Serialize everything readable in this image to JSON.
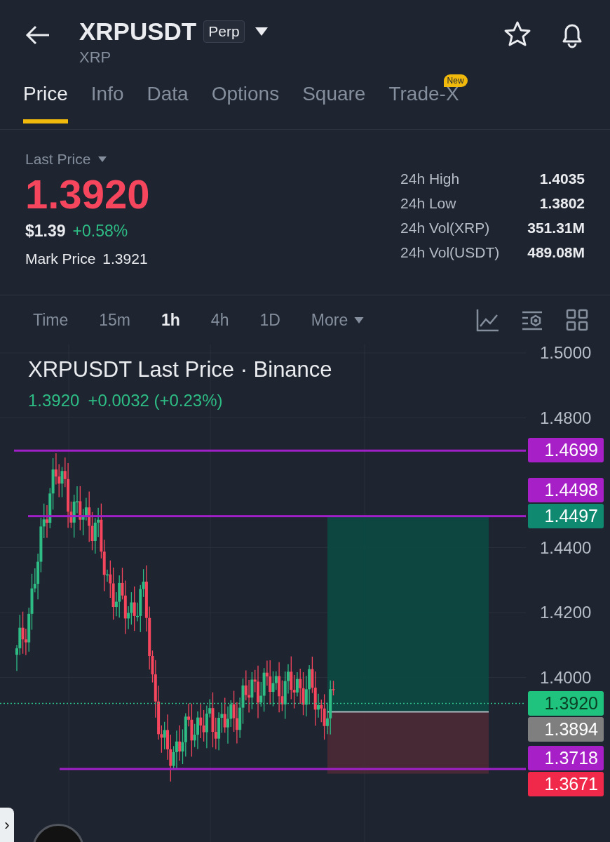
{
  "header": {
    "symbol": "XRPUSDT",
    "badge": "Perp",
    "subtitle": "XRP"
  },
  "tabs": [
    {
      "label": "Price",
      "selected": true
    },
    {
      "label": "Info",
      "selected": false
    },
    {
      "label": "Data",
      "selected": false
    },
    {
      "label": "Options",
      "selected": false
    },
    {
      "label": "Square",
      "selected": false
    },
    {
      "label": "Trade-X",
      "selected": false,
      "badge": "New"
    }
  ],
  "price": {
    "label": "Last Price",
    "value": "1.3920",
    "usd": "$1.39",
    "change": "+0.58%",
    "mark_label": "Mark Price",
    "mark_value": "1.3921"
  },
  "stats": [
    {
      "label": "24h High",
      "value": "1.4035"
    },
    {
      "label": "24h Low",
      "value": "1.3802"
    },
    {
      "label": "24h Vol(XRP)",
      "value": "351.31M"
    },
    {
      "label": "24h Vol(USDT)",
      "value": "489.08M"
    }
  ],
  "intervals": [
    {
      "label": "Time",
      "selected": false
    },
    {
      "label": "15m",
      "selected": false
    },
    {
      "label": "1h",
      "selected": true
    },
    {
      "label": "4h",
      "selected": false
    },
    {
      "label": "1D",
      "selected": false
    }
  ],
  "more": "More",
  "chart": {
    "title": "XRPUSDT Last Price · Binance",
    "last": "1.3920",
    "change": "+0.0032 (+0.23%)",
    "y_ticks": [
      "1.5000",
      "1.4800",
      "1.4400",
      "1.4200",
      "1.4000"
    ],
    "tags": [
      {
        "value": "1.4699",
        "color": "#a71fc6",
        "line": true
      },
      {
        "value": "1.4498",
        "color": "#a71fc6",
        "line": false
      },
      {
        "value": "1.4497",
        "color": "#0f8a70",
        "line": true
      },
      {
        "value": "1.3920",
        "color": "#1fc37d",
        "line": false
      },
      {
        "value": "1.3894",
        "color": "#7f7f7f",
        "line": false
      },
      {
        "value": "1.3718",
        "color": "#a71fc6",
        "line": true
      },
      {
        "value": "1.3671",
        "color": "#f0294a",
        "line": false
      }
    ]
  },
  "side_handle": "›"
}
